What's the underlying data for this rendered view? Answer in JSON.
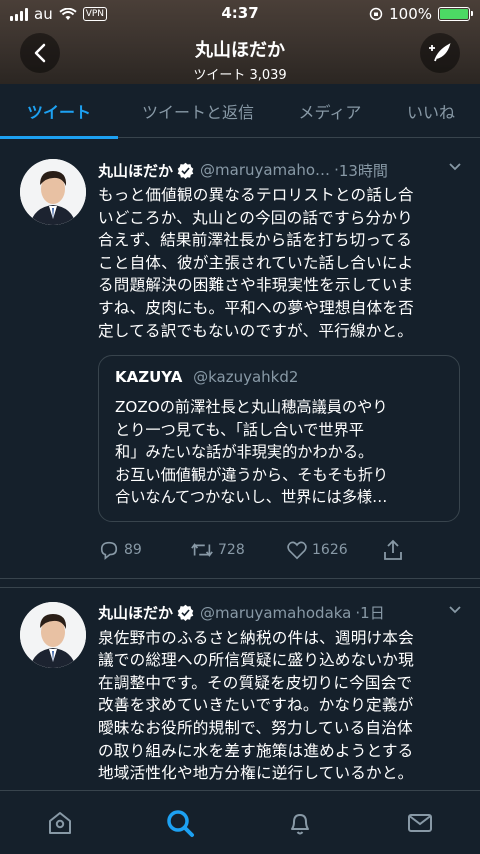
{
  "status": {
    "carrier": "au",
    "vpn": "VPN",
    "time": "4:37",
    "battery": "100%"
  },
  "header": {
    "title": "丸山ほだか",
    "subtitle": "ツイート 3,039"
  },
  "tabs": [
    {
      "label": "ツイート",
      "active": true
    },
    {
      "label": "ツイートと返信",
      "active": false
    },
    {
      "label": "メディア",
      "active": false
    },
    {
      "label": "いいね",
      "active": false
    }
  ],
  "tweets": [
    {
      "name": "丸山ほだか",
      "handle": "@maruyamaho…",
      "time": "13時間",
      "lines": [
        "もっと価値観の異なるテロリストとの話し合",
        "いどころか、丸山との今回の話ですら分かり",
        "合えず、結果前澤社長から話を打ち切ってる",
        "こと自体、彼が主張されていた話し合いによ",
        "る問題解決の困難さや非現実性を示していま",
        "すね、皮肉にも。平和への夢や理想自体を否",
        "定してる訳でもないのですが、平行線かと。"
      ],
      "quote": {
        "name": "KAZUYA",
        "handle": "@kazuyahkd2",
        "lines": [
          "ZOZOの前澤社長と丸山穂高議員のやり",
          "とり一つ見ても、「話し合いで世界平",
          "和」みたいな話が非現実的かわかる。",
          "お互い価値観が違うから、そもそも折り",
          "合いなんてつかないし、世界には多様…"
        ]
      },
      "replies": "89",
      "retweets": "728",
      "likes": "1626"
    },
    {
      "name": "丸山ほだか",
      "handle": "@maruyamahodaka",
      "time": "1日",
      "lines": [
        "泉佐野市のふるさと納税の件は、週明け本会",
        "議での総理への所信質疑に盛り込めないか現",
        "在調整中です。その質疑を皮切りに今国会で",
        "改善を求めていきたいですね。かなり定義が",
        "曖昧なお役所的規制で、努力している自治体",
        "の取り組みに水を差す施策は進めようとする",
        "地域活性化や地方分権に逆行しているかと。"
      ]
    }
  ],
  "colors": {
    "bg": "#15202b",
    "accent": "#1da1f2",
    "muted": "#8899a6",
    "border": "#38444d"
  }
}
